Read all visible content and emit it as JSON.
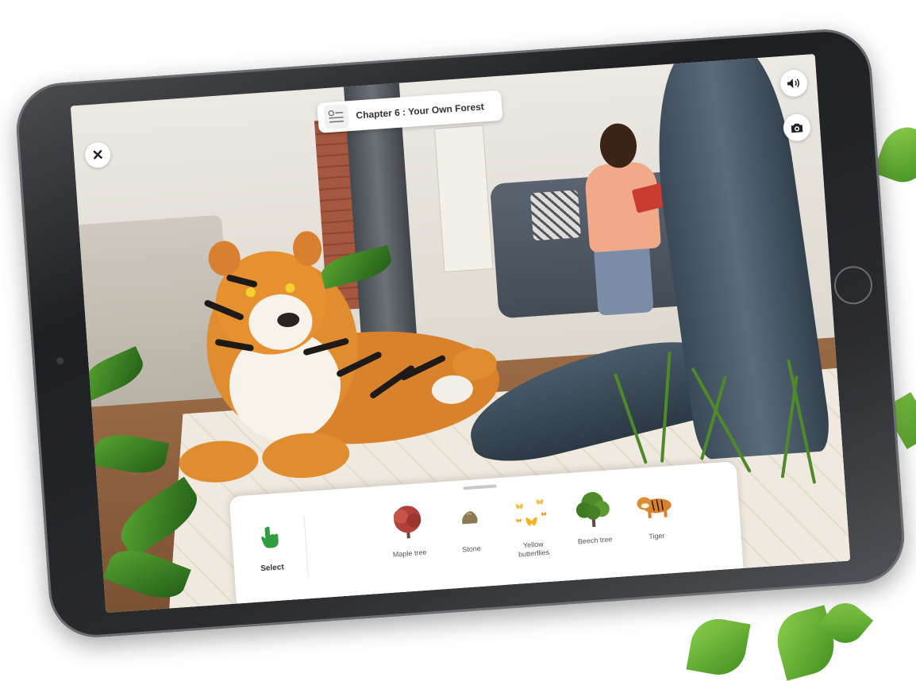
{
  "chapter": {
    "title": "Chapter 6 : Your Own Forest",
    "icon": "chapter-list-icon"
  },
  "controls": {
    "close_icon": "close-icon",
    "sound_icon": "speaker-icon",
    "camera_icon": "camera-icon"
  },
  "palette": {
    "select": {
      "label": "Select",
      "icon": "hand-pointer-icon",
      "color": "#2e9e3e"
    },
    "items": [
      {
        "label": "Maple tree",
        "icon": "maple-tree-icon"
      },
      {
        "label": "Stone",
        "icon": "stone-icon"
      },
      {
        "label": "Yellow butterflies",
        "icon": "butterflies-icon"
      },
      {
        "label": "Beech tree",
        "icon": "beech-tree-icon"
      },
      {
        "label": "Tiger",
        "icon": "tiger-icon"
      }
    ]
  }
}
